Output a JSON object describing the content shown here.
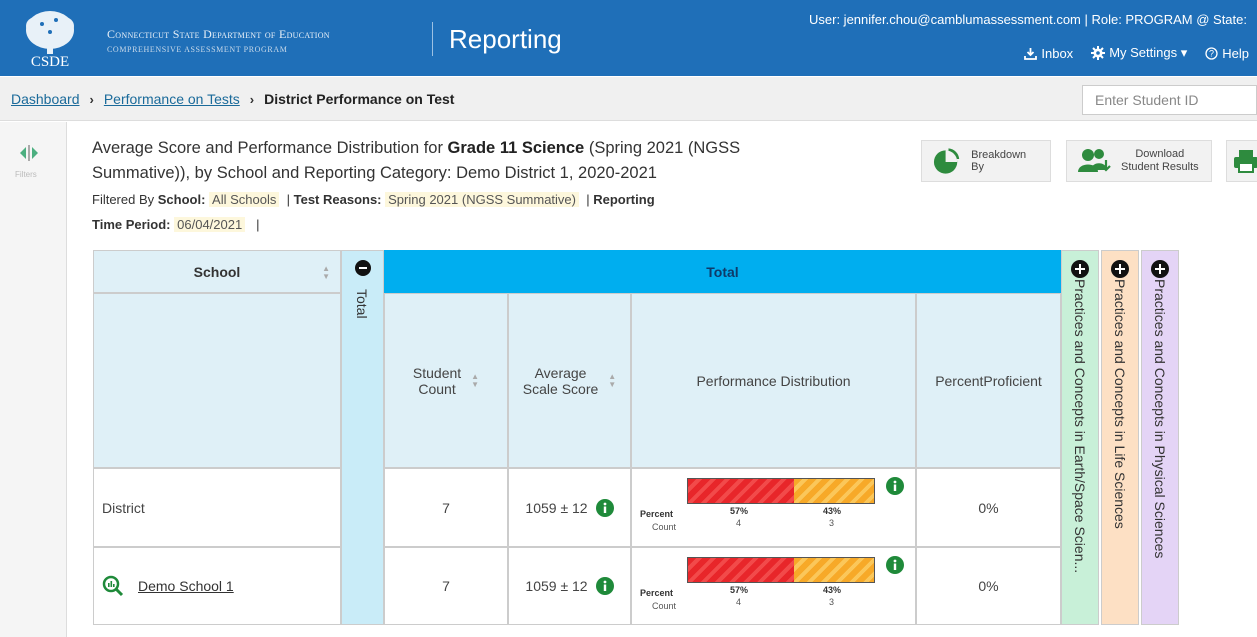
{
  "header": {
    "org_line1": "Connecticut State Department of Education",
    "org_line2": "COMPREHENSIVE ASSESSMENT PROGRAM",
    "app_title": "Reporting",
    "logo_text": "CSDE",
    "user_line": "User: jennifer.chou@camblumassessment.com  |  Role: PROGRAM @ State:",
    "inbox": "Inbox",
    "my_settings": "My Settings ▾",
    "help": "Help"
  },
  "breadcrumb": {
    "dashboard": "Dashboard",
    "performance": "Performance on Tests",
    "current": "District Performance on Test",
    "sep": "›"
  },
  "student_search": {
    "placeholder": "Enter Student ID"
  },
  "filters_rail": {
    "label": "Filters"
  },
  "report": {
    "title_prefix": "Average Score and Performance Distribution for ",
    "title_bold": "Grade 11 Science",
    "title_suffix": " (Spring 2021 (NGSS Summative)), by School and Reporting Category: Demo District 1, 2020-2021",
    "filtered_by": "Filtered By ",
    "school_label": "School:",
    "school_value": "All Schools",
    "test_reasons_label": "Test Reasons:",
    "test_reasons_value": "Spring 2021 (NGSS Summative)",
    "reporting_label": "Reporting",
    "time_period_label": "Time Period:",
    "time_period_value": "06/04/2021",
    "pipe": "|"
  },
  "toolbar": {
    "breakdown": "Breakdown By",
    "download_l1": "Download",
    "download_l2": "Student Results"
  },
  "table": {
    "school_header": "School",
    "total_collapsed": "Total",
    "total_band": "Total",
    "student_count_l1": "Student",
    "student_count_l2": "Count",
    "avg_score_l1": "Average",
    "avg_score_l2": "Scale Score",
    "perf_dist": "Performance Distribution",
    "pct_proficient": "PercentProficient",
    "categories": [
      "Practices and Concepts in Earth/Space Scien...",
      "Practices and Concepts in Life Sciences",
      "Practices and Concepts in Physical Sciences"
    ],
    "rows": [
      {
        "school": "District",
        "student_count": "7",
        "avg_score": "1059 ± 12",
        "percent_label": "Percent",
        "count_label": "Count",
        "pct_low": "57%",
        "pct_high": "43%",
        "cnt_low": "4",
        "cnt_high": "3",
        "frac_low": 0.57,
        "pct_proficient": "0%"
      },
      {
        "school": "Demo School 1",
        "student_count": "7",
        "avg_score": "1059 ± 12",
        "percent_label": "Percent",
        "count_label": "Count",
        "pct_low": "57%",
        "pct_high": "43%",
        "cnt_low": "4",
        "cnt_high": "3",
        "frac_low": 0.57,
        "pct_proficient": "0%"
      }
    ]
  },
  "colors": {
    "header_blue": "#1f6fb8",
    "total_band": "#00aeef",
    "level_low": "#e8262a",
    "level_mid": "#f7a928",
    "info_green": "#1f8a3a"
  }
}
